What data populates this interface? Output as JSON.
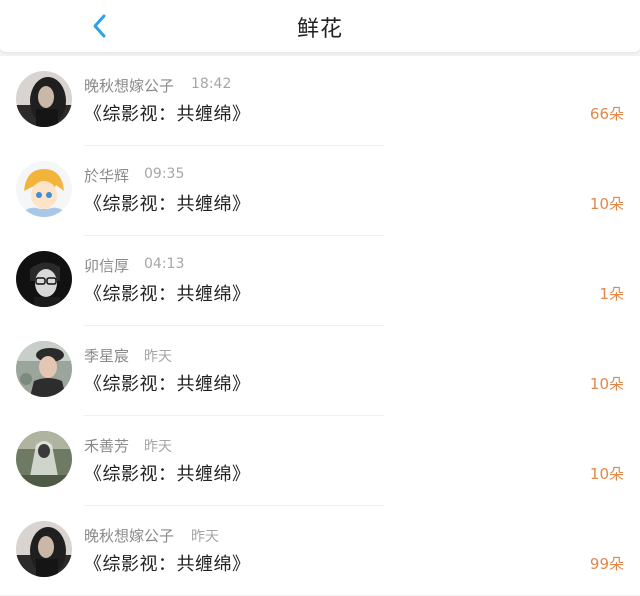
{
  "header": {
    "title": "鲜花",
    "back_icon": "chevron-left-icon",
    "accent_color": "#2aa2e4"
  },
  "gifts": [
    {
      "user": "晚秋想嫁公子",
      "time": "18:42",
      "book": "《综影视：共缠绵》",
      "count": "66朵",
      "avatar_icon": "avatar-woman-dark-hair"
    },
    {
      "user": "於华辉",
      "time": "09:35",
      "book": "《综影视：共缠绵》",
      "count": "10朵",
      "avatar_icon": "avatar-anime-blonde"
    },
    {
      "user": "卯信厚",
      "time": "04:13",
      "book": "《综影视：共缠绵》",
      "count": "1朵",
      "avatar_icon": "avatar-glasses-monochrome"
    },
    {
      "user": "季星宸",
      "time": "昨天",
      "book": "《综影视：共缠绵》",
      "count": "10朵",
      "avatar_icon": "avatar-photo-hat"
    },
    {
      "user": "禾善芳",
      "time": "昨天",
      "book": "《综影视：共缠绵》",
      "count": "10朵",
      "avatar_icon": "avatar-veiled-figure"
    },
    {
      "user": "晚秋想嫁公子",
      "time": "昨天",
      "book": "《综影视：共缠绵》",
      "count": "99朵",
      "avatar_icon": "avatar-woman-dark-hair"
    }
  ],
  "colors": {
    "count_color": "#e0884a",
    "name_color": "#8a8a8a",
    "title_color": "#222222"
  }
}
